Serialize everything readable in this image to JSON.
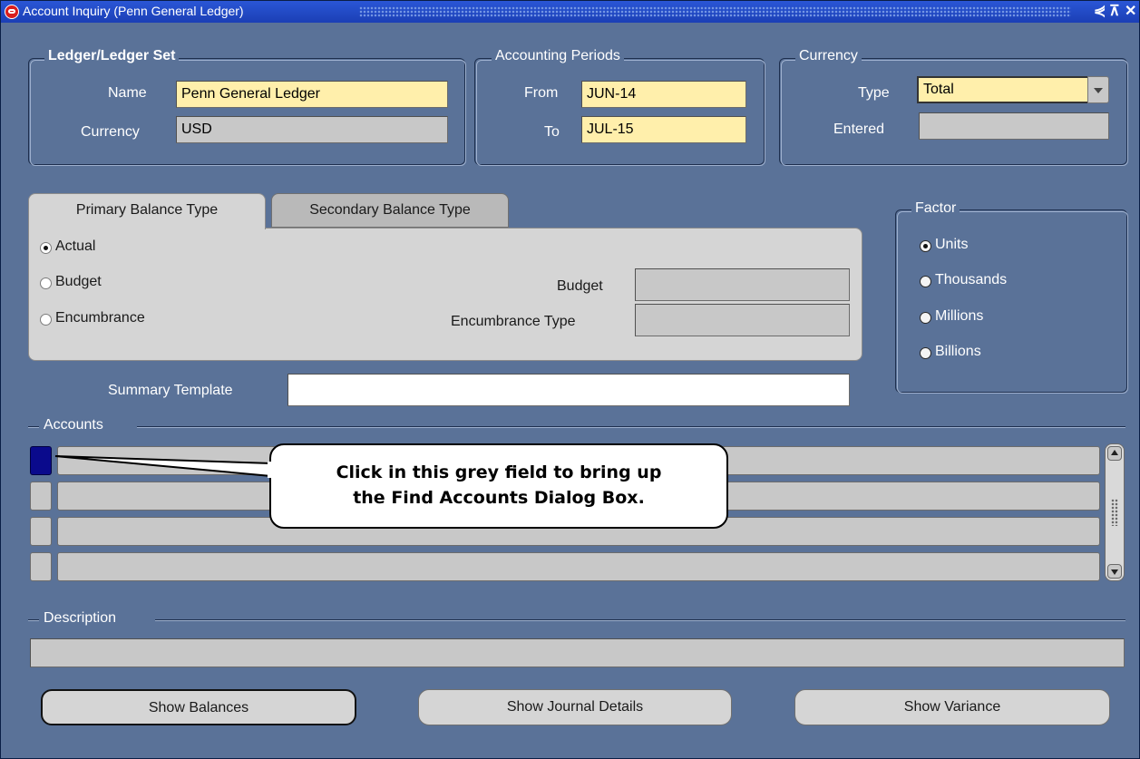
{
  "window": {
    "title": "Account Inquiry (Penn General Ledger)",
    "controls": [
      "⋞",
      "⊼",
      "✕"
    ]
  },
  "ledger": {
    "group_label": "Ledger/Ledger Set",
    "name_label": "Name",
    "name_value": "Penn General Ledger",
    "currency_label": "Currency",
    "currency_value": "USD"
  },
  "periods": {
    "group_label": "Accounting Periods",
    "from_label": "From",
    "from_value": "JUN-14",
    "to_label": "To",
    "to_value": "JUL-15"
  },
  "currency": {
    "group_label": "Currency",
    "type_label": "Type",
    "type_value": "Total",
    "entered_label": "Entered",
    "entered_value": ""
  },
  "tabs": {
    "primary": "Primary Balance Type",
    "secondary": "Secondary Balance Type"
  },
  "balance_type": {
    "options": [
      "Actual",
      "Budget",
      "Encumbrance"
    ],
    "selected": "Actual",
    "budget_label": "Budget",
    "budget_value": "",
    "encumbrance_label": "Encumbrance Type",
    "encumbrance_value": ""
  },
  "factor": {
    "group_label": "Factor",
    "options": [
      "Units",
      "Thousands",
      "Millions",
      "Billions"
    ],
    "selected": "Units"
  },
  "summary": {
    "label": "Summary Template",
    "value": ""
  },
  "accounts": {
    "section_label": "Accounts",
    "rows": [
      "",
      "",
      "",
      ""
    ]
  },
  "description": {
    "section_label": "Description",
    "value": ""
  },
  "callout": {
    "line1": "Click in this grey field to bring up",
    "line2": "the Find Accounts Dialog Box."
  },
  "buttons": {
    "show_balances": "Show Balances",
    "show_journal_details": "Show Journal Details",
    "show_variance": "Show Variance"
  },
  "colors": {
    "window_bg": "#5a7298",
    "titlebar": "#2a56d6",
    "required_field": "#ffefab",
    "readonly_field": "#c8c8c8",
    "current_row": "#0a0a8c"
  }
}
